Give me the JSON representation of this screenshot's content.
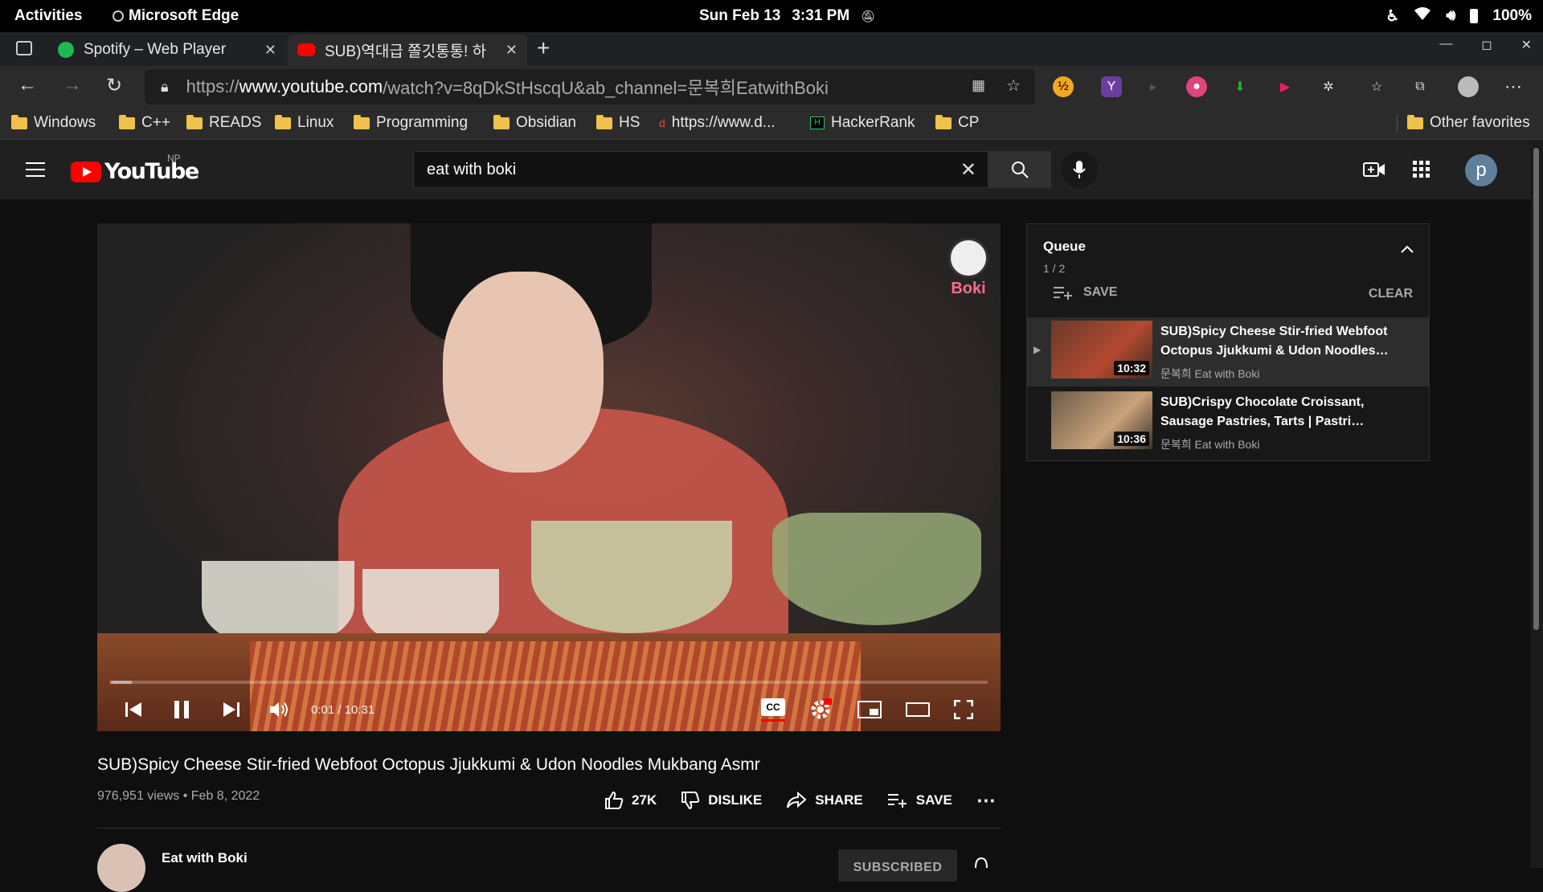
{
  "system_bar": {
    "activities": "Activities",
    "app_name": "Microsoft Edge",
    "date": "Sun Feb 13",
    "time": "3:31 PM",
    "battery": "100%"
  },
  "browser": {
    "tabs": [
      {
        "title": "Spotify – Web Player",
        "favicon_color": "#1db954"
      },
      {
        "title": "SUB)역대급 쫄깃통통! 하",
        "favicon_color": "#ff0000"
      }
    ],
    "url_prefix": "https://",
    "url_host": "www.youtube.com",
    "url_path": "/watch?v=8qDkStHscqU&ab_channel=문복희EatwithBoki",
    "favorites": [
      {
        "label": "Windows",
        "type": "folder"
      },
      {
        "label": "C++",
        "type": "folder"
      },
      {
        "label": "READS",
        "type": "folder"
      },
      {
        "label": "Linux",
        "type": "folder"
      },
      {
        "label": "Programming",
        "type": "folder"
      },
      {
        "label": "Obsidian",
        "type": "folder"
      },
      {
        "label": "HS",
        "type": "folder"
      },
      {
        "label": "https://www.d...",
        "type": "link"
      },
      {
        "label": "HackerRank",
        "type": "link"
      },
      {
        "label": "CP",
        "type": "folder"
      }
    ],
    "other_favorites": "Other favorites"
  },
  "youtube": {
    "logo_text": "YouTube",
    "region": "NP",
    "search_value": "eat with boki",
    "avatar_letter": "p",
    "player": {
      "current_time": "0:01",
      "total_time": "10:31",
      "time_display": "0:01 / 10:31",
      "watermark": "Boki",
      "progress_fraction": 0.0016
    },
    "video": {
      "title": "SUB)Spicy Cheese Stir-fried Webfoot Octopus Jjukkumi & Udon Noodles Mukbang Asmr",
      "views": "976,951 views",
      "date": "Feb 8, 2022",
      "meta": "976,951 views • Feb 8, 2022",
      "likes": "27K",
      "dislike_label": "DISLIKE",
      "share_label": "SHARE",
      "save_label": "SAVE",
      "channel_name": "Eat with Boki",
      "subscribe_label": "SUBSCRIBED"
    },
    "queue": {
      "title": "Queue",
      "count": "1 / 2",
      "save_label": "SAVE",
      "clear_label": "CLEAR",
      "items": [
        {
          "title": "SUB)Spicy Cheese Stir-fried Webfoot Octopus Jjukkumi & Udon Noodles…",
          "channel": "문복희 Eat with Boki",
          "duration": "10:32",
          "current": true
        },
        {
          "title": "SUB)Crispy Chocolate Croissant, Sausage Pastries, Tarts | Pastri…",
          "channel": "문복희 Eat with Boki",
          "duration": "10:36",
          "current": false
        }
      ]
    }
  }
}
